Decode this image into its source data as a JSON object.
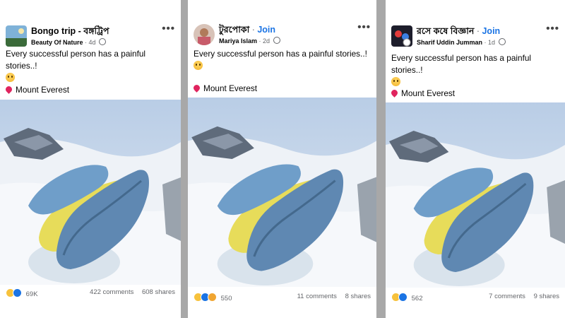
{
  "posts": [
    {
      "page_name": "Bongo trip - বঙ্গট্রিপ",
      "join_label": "",
      "author": "Beauty Of Nature",
      "time": "4d",
      "caption": "Every successful person has a painful stories..!",
      "location": "Mount Everest",
      "reactions": [
        "sad",
        "like"
      ],
      "reaction_count": "69K",
      "comments": "422 comments",
      "shares": "608 shares"
    },
    {
      "page_name": "টুরপোকা",
      "join_label": "Join",
      "author": "Mariya Islam",
      "time": "2d",
      "caption": "Every successful person has a painful stories..!",
      "location": "Mount Everest",
      "reactions": [
        "sad",
        "like",
        "wow"
      ],
      "reaction_count": "550",
      "comments": "11 comments",
      "shares": "8 shares"
    },
    {
      "page_name": "রসে কষে বিজ্ঞান",
      "join_label": "Join",
      "author": "Sharif Uddin Jumman",
      "time": "1d",
      "caption": "Every successful person has a painful stories..!",
      "location": "Mount Everest",
      "reactions": [
        "sad",
        "like"
      ],
      "reaction_count": "562",
      "comments": "7 comments",
      "shares": "9 shares"
    }
  ],
  "icons": {
    "more": "more-options-icon",
    "privacy": "globe-icon",
    "pin": "pushpin-icon",
    "emoji": "crying-face-icon"
  },
  "colors": {
    "join": "#1b74e4",
    "divider": "#a8a8a8",
    "meta": "#65676b"
  }
}
